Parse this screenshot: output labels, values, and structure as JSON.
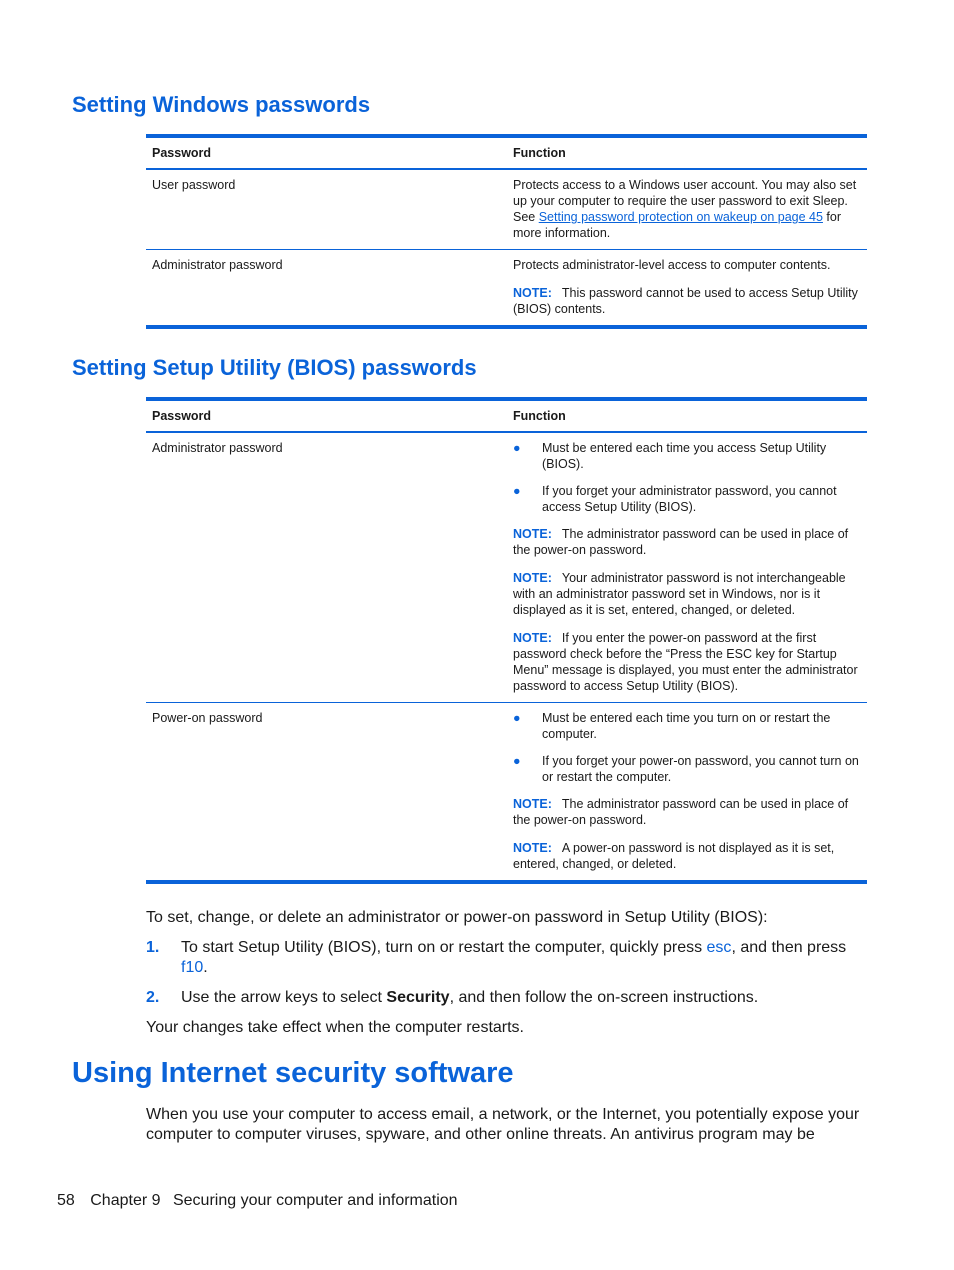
{
  "section1": {
    "title": "Setting Windows passwords",
    "headers": [
      "Password",
      "Function"
    ],
    "rows": [
      {
        "password": "User password",
        "function_pre": "Protects access to a Windows user account. You may also set up your computer to require the user password to exit Sleep. See ",
        "link": "Setting password protection on wakeup on page 45",
        "function_post": " for more information."
      },
      {
        "password": "Administrator password",
        "function": "Protects administrator-level access to computer contents.",
        "note_label": "NOTE:",
        "note": "This password cannot be used to access Setup Utility (BIOS) contents."
      }
    ]
  },
  "section2": {
    "title": "Setting Setup Utility (BIOS) passwords",
    "headers": [
      "Password",
      "Function"
    ],
    "bullet_glyph": "●",
    "note_label": "NOTE:",
    "rows": [
      {
        "password": "Administrator password",
        "bullets": [
          "Must be entered each time you access Setup Utility (BIOS).",
          "If you forget your administrator password, you cannot access Setup Utility (BIOS)."
        ],
        "notes": [
          "The administrator password can be used in place of the power-on password.",
          "Your administrator password is not interchangeable with an administrator password set in Windows, nor is it displayed as it is set, entered, changed, or deleted.",
          "If you enter the power-on password at the first password check before the “Press the ESC key for Startup Menu” message is displayed, you must enter the administrator password to access Setup Utility (BIOS)."
        ]
      },
      {
        "password": "Power-on password",
        "bullets": [
          "Must be entered each time you turn on or restart the computer.",
          "If you forget your power-on password, you cannot turn on or restart the computer."
        ],
        "notes": [
          "The administrator password can be used in place of the power-on password.",
          "A power-on password is not displayed as it is set, entered, changed, or deleted."
        ]
      }
    ]
  },
  "procedure": {
    "intro": "To set, change, or delete an administrator or power-on password in Setup Utility (BIOS):",
    "steps": [
      {
        "num": "1.",
        "pre": "To start Setup Utility (BIOS), turn on or restart the computer, quickly press ",
        "key1": "esc",
        "mid": ", and then press ",
        "key2": "f10",
        "post": "."
      },
      {
        "num": "2.",
        "pre": "Use the arrow keys to select ",
        "bold": "Security",
        "post": ", and then follow the on-screen instructions."
      }
    ],
    "outro": "Your changes take effect when the computer restarts."
  },
  "section3": {
    "title": "Using Internet security software",
    "body": "When you use your computer to access email, a network, or the Internet, you potentially expose your computer to computer viruses, spyware, and other online threats. An antivirus program may be"
  },
  "footer": {
    "page_number": "58",
    "chapter": "Chapter 9",
    "chapter_title": "Securing your computer and information"
  }
}
